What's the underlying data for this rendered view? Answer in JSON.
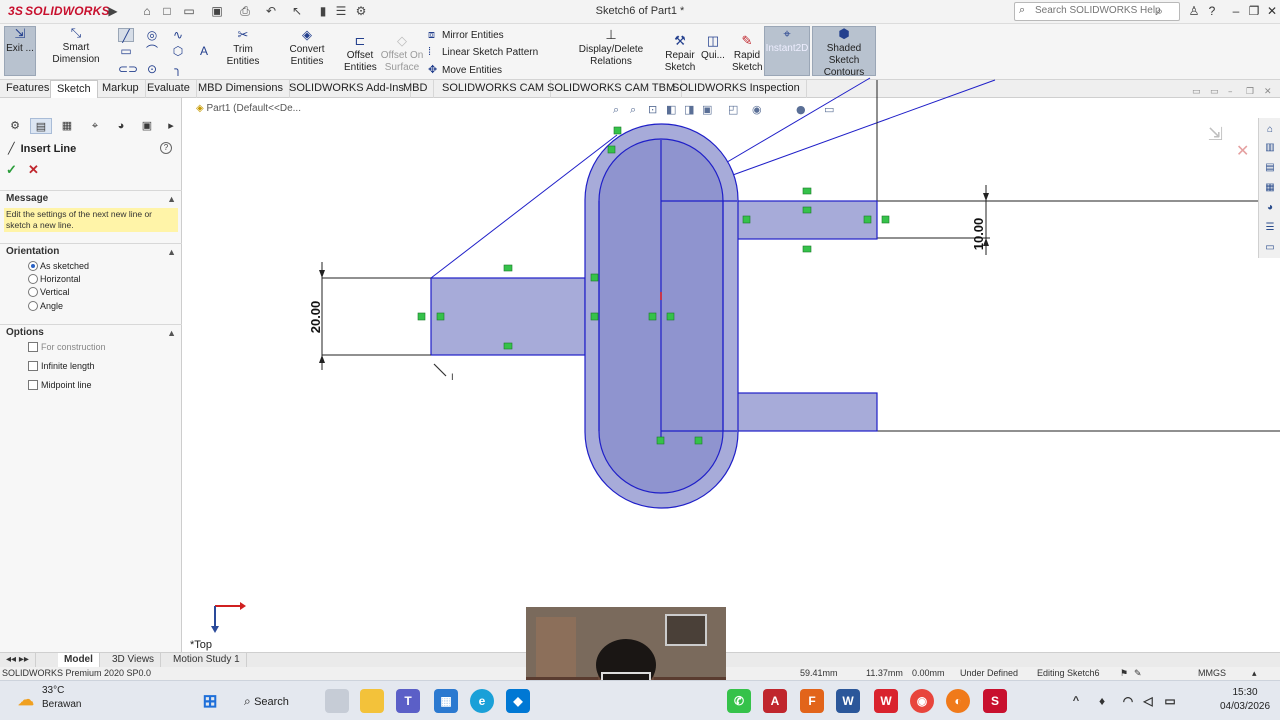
{
  "app": {
    "logo_text": "SOLIDWORKS",
    "document_title": "Sketch6 of Part1 *",
    "help_search_placeholder": "Search SOLIDWORKS Help"
  },
  "command_manager": {
    "exit_sketch": "Exit ...",
    "smart_dimension": "Smart Dimension",
    "trim_entities": "Trim Entities",
    "convert_entities": "Convert Entities",
    "offset_entities_line1": "Offset",
    "offset_entities_line2": "Entities",
    "offset_on_surface_line1": "Offset On",
    "offset_on_surface_line2": "Surface",
    "mirror_entities": "Mirror Entities",
    "linear_sketch_pattern": "Linear Sketch Pattern",
    "move_entities": "Move Entities",
    "display_delete_relations": "Display/Delete Relations",
    "repair_sketch_line1": "Repair",
    "repair_sketch_line2": "Sketch",
    "quick_snaps": "Qui...",
    "rapid_sketch_line1": "Rapid",
    "rapid_sketch_line2": "Sketch",
    "instant2d": "Instant2D",
    "shaded_contours_line1": "Shaded Sketch",
    "shaded_contours_line2": "Contours"
  },
  "tabs": [
    "Features",
    "Sketch",
    "Markup",
    "Evaluate",
    "MBD Dimensions",
    "SOLIDWORKS Add-Ins",
    "MBD",
    "SOLIDWORKS CAM",
    "SOLIDWORKS CAM TBM",
    "SOLIDWORKS Inspection"
  ],
  "active_tab": "Sketch",
  "property_manager": {
    "title": "Insert Line",
    "message_header": "Message",
    "message_text": "Edit the settings of the next new line or sketch a new line.",
    "orientation_header": "Orientation",
    "orientation_options": [
      "As sketched",
      "Horizontal",
      "Vertical",
      "Angle"
    ],
    "orientation_selected": "As sketched",
    "options_header": "Options",
    "options": [
      "For construction",
      "Infinite length",
      "Midpoint line"
    ]
  },
  "graphics": {
    "tree_label": "Part1  (Default<<De...",
    "view_label": "*Top",
    "dimensions": [
      "20.00",
      "10.00"
    ]
  },
  "bottom_tabs": [
    "Model",
    "3D Views",
    "Motion Study 1"
  ],
  "active_bottom_tab": "Model",
  "status": {
    "product": "SOLIDWORKS Premium 2020 SP0.0",
    "x": "59.41mm",
    "y": "11.37mm",
    "z": "0.00mm",
    "sketch_state": "Under Defined",
    "editing": "Editing Sketch6",
    "units": "MMGS"
  },
  "taskbar": {
    "temperature": "33°C",
    "weather": "Berawan",
    "search_label": "Search",
    "time": "15:30",
    "date": "04/03/2026"
  },
  "colors": {
    "sketch_fill": "#8f94cf",
    "sketch_line": "#1f1fc8",
    "relation_green": "#35c24a",
    "message_bg": "#fff4a8",
    "logo_red": "#c8102e"
  }
}
